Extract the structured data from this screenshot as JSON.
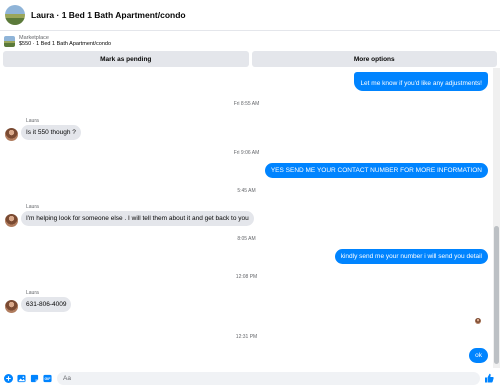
{
  "header": {
    "title": "Laura · 1 Bed 1 Bath Apartment/condo"
  },
  "listing": {
    "label": "Marketplace",
    "subtitle": "$550 · 1 Bed 1 Bath Apartment/condo"
  },
  "actions": {
    "mark_pending": "Mark as pending",
    "more_options": "More options"
  },
  "messages": {
    "out_top": "Let me know if you'd like any adjustments!",
    "ts1": "Fri 8:55 AM",
    "name1": "Laura",
    "in1": "Is it 550 though ?",
    "ts2": "Fri 9:06 AM",
    "out1": "YES SEND ME YOUR  CONTACT NUMBER FOR MORE INFORMATION",
    "ts3": "5:45 AM",
    "name2": "Laura",
    "in2": "I'm helping look for someone else . I will tell them about it and get back to you",
    "ts4": "8:05 AM",
    "out2": "kindly send me your number i will send you detail",
    "ts5": "12:08 PM",
    "name3": "Laura",
    "in3": "631-806-4009",
    "ts6": "12:31 PM",
    "out3": "ok"
  },
  "composer": {
    "placeholder": "Aa"
  },
  "colors": {
    "accent": "#0084ff",
    "bubble_in": "#e4e6eb"
  },
  "icons": [
    "plus-circle-icon",
    "image-icon",
    "sticker-icon",
    "gif-icon",
    "emoji-icon",
    "thumbs-up-icon"
  ]
}
